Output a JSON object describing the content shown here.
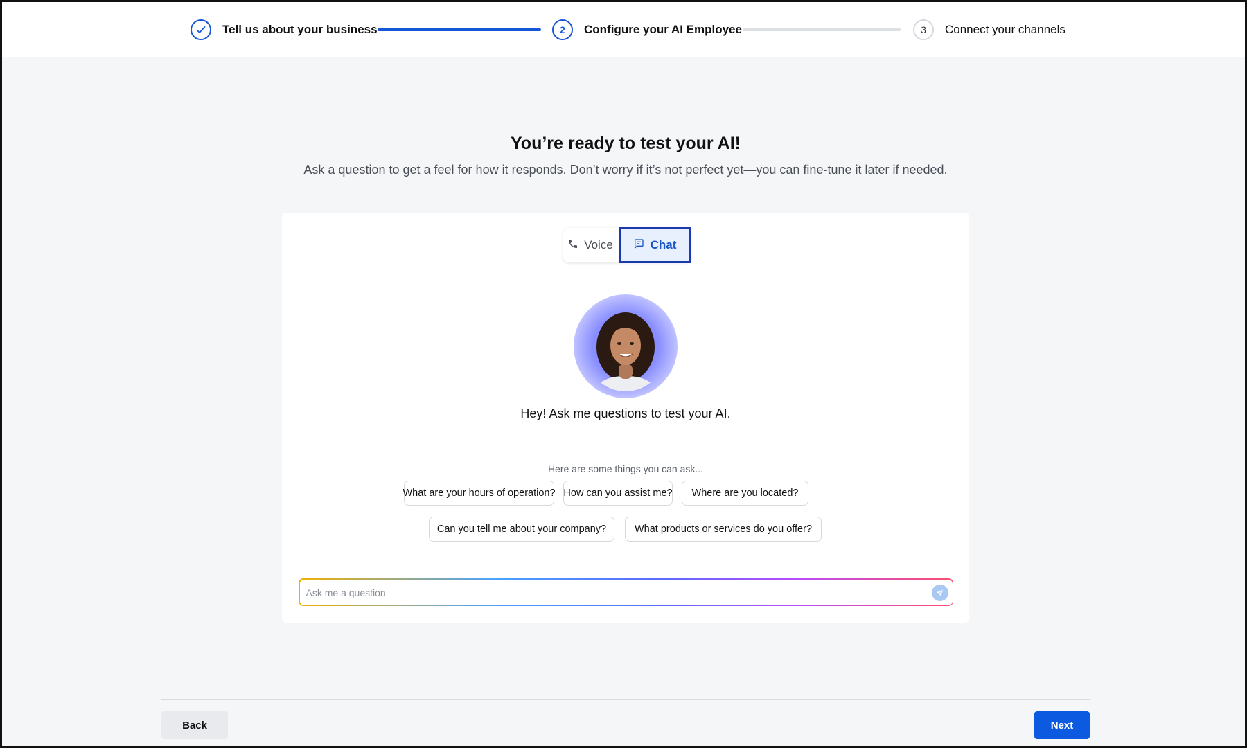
{
  "stepper": {
    "steps": [
      {
        "number": "",
        "label": "Tell us about your business",
        "status": "completed"
      },
      {
        "number": "2",
        "label": "Configure your AI Employee",
        "status": "active"
      },
      {
        "number": "3",
        "label": "Connect your channels",
        "status": "upcoming"
      }
    ]
  },
  "main": {
    "title": "You’re ready to test your AI!",
    "subtitle": "Ask a question to get a feel for how it responds. Don’t worry if it’s not perfect yet—you can fine-tune it later if needed."
  },
  "mode_toggle": {
    "voice_label": "Voice",
    "chat_label": "Chat",
    "selected": "Chat"
  },
  "assistant": {
    "greeting": "Hey! Ask me questions to test your AI."
  },
  "suggestions": {
    "hint": "Here are some things you can ask...",
    "chips": [
      "What are your hours of operation?",
      "How can you assist me?",
      "Where are you located?",
      "Can you tell me about your company?",
      "What products or services do you offer?"
    ]
  },
  "chat_input": {
    "placeholder": "Ask me a question",
    "value": ""
  },
  "footer": {
    "back_label": "Back",
    "next_label": "Next"
  },
  "colors": {
    "accent": "#1557d6",
    "primary_button": "#0b5ae0",
    "background": "#f5f6f8"
  }
}
